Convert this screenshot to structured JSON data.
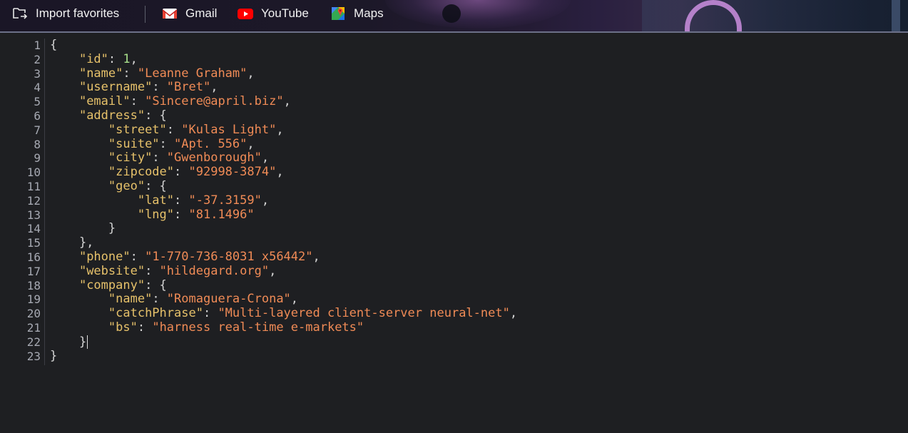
{
  "bookmarks": {
    "import_label": "Import favorites",
    "items": [
      {
        "label": "Gmail",
        "icon": "gmail-icon"
      },
      {
        "label": "YouTube",
        "icon": "youtube-icon"
      },
      {
        "label": "Maps",
        "icon": "maps-icon"
      }
    ]
  },
  "colors": {
    "key": "#e6c16a",
    "string": "#f08b56",
    "number": "#a8e08b",
    "punct": "#d4d4d4",
    "background": "#1e1f22"
  },
  "editor": {
    "lines": [
      [
        [
          "p",
          "{"
        ]
      ],
      [
        [
          "p",
          "    "
        ],
        [
          "k",
          "\"id\""
        ],
        [
          "p",
          ": "
        ],
        [
          "n",
          "1"
        ],
        [
          "p",
          ","
        ]
      ],
      [
        [
          "p",
          "    "
        ],
        [
          "k",
          "\"name\""
        ],
        [
          "p",
          ": "
        ],
        [
          "s",
          "\"Leanne Graham\""
        ],
        [
          "p",
          ","
        ]
      ],
      [
        [
          "p",
          "    "
        ],
        [
          "k",
          "\"username\""
        ],
        [
          "p",
          ": "
        ],
        [
          "s",
          "\"Bret\""
        ],
        [
          "p",
          ","
        ]
      ],
      [
        [
          "p",
          "    "
        ],
        [
          "k",
          "\"email\""
        ],
        [
          "p",
          ": "
        ],
        [
          "s",
          "\"Sincere@april.biz\""
        ],
        [
          "p",
          ","
        ]
      ],
      [
        [
          "p",
          "    "
        ],
        [
          "k",
          "\"address\""
        ],
        [
          "p",
          ": {"
        ]
      ],
      [
        [
          "p",
          "        "
        ],
        [
          "k",
          "\"street\""
        ],
        [
          "p",
          ": "
        ],
        [
          "s",
          "\"Kulas Light\""
        ],
        [
          "p",
          ","
        ]
      ],
      [
        [
          "p",
          "        "
        ],
        [
          "k",
          "\"suite\""
        ],
        [
          "p",
          ": "
        ],
        [
          "s",
          "\"Apt. 556\""
        ],
        [
          "p",
          ","
        ]
      ],
      [
        [
          "p",
          "        "
        ],
        [
          "k",
          "\"city\""
        ],
        [
          "p",
          ": "
        ],
        [
          "s",
          "\"Gwenborough\""
        ],
        [
          "p",
          ","
        ]
      ],
      [
        [
          "p",
          "        "
        ],
        [
          "k",
          "\"zipcode\""
        ],
        [
          "p",
          ": "
        ],
        [
          "s",
          "\"92998-3874\""
        ],
        [
          "p",
          ","
        ]
      ],
      [
        [
          "p",
          "        "
        ],
        [
          "k",
          "\"geo\""
        ],
        [
          "p",
          ": {"
        ]
      ],
      [
        [
          "p",
          "            "
        ],
        [
          "k",
          "\"lat\""
        ],
        [
          "p",
          ": "
        ],
        [
          "s",
          "\"-37.3159\""
        ],
        [
          "p",
          ","
        ]
      ],
      [
        [
          "p",
          "            "
        ],
        [
          "k",
          "\"lng\""
        ],
        [
          "p",
          ": "
        ],
        [
          "s",
          "\"81.1496\""
        ]
      ],
      [
        [
          "p",
          "        }"
        ]
      ],
      [
        [
          "p",
          "    },"
        ]
      ],
      [
        [
          "p",
          "    "
        ],
        [
          "k",
          "\"phone\""
        ],
        [
          "p",
          ": "
        ],
        [
          "s",
          "\"1-770-736-8031 x56442\""
        ],
        [
          "p",
          ","
        ]
      ],
      [
        [
          "p",
          "    "
        ],
        [
          "k",
          "\"website\""
        ],
        [
          "p",
          ": "
        ],
        [
          "s",
          "\"hildegard.org\""
        ],
        [
          "p",
          ","
        ]
      ],
      [
        [
          "p",
          "    "
        ],
        [
          "k",
          "\"company\""
        ],
        [
          "p",
          ": {"
        ]
      ],
      [
        [
          "p",
          "        "
        ],
        [
          "k",
          "\"name\""
        ],
        [
          "p",
          ": "
        ],
        [
          "s",
          "\"Romaguera-Crona\""
        ],
        [
          "p",
          ","
        ]
      ],
      [
        [
          "p",
          "        "
        ],
        [
          "k",
          "\"catchPhrase\""
        ],
        [
          "p",
          ": "
        ],
        [
          "s",
          "\"Multi-layered client-server neural-net\""
        ],
        [
          "p",
          ","
        ]
      ],
      [
        [
          "p",
          "        "
        ],
        [
          "k",
          "\"bs\""
        ],
        [
          "p",
          ": "
        ],
        [
          "s",
          "\"harness real-time e-markets\""
        ]
      ],
      [
        [
          "p",
          "    }"
        ]
      ],
      [
        [
          "p",
          "}"
        ]
      ]
    ],
    "cursor_line": 22
  }
}
